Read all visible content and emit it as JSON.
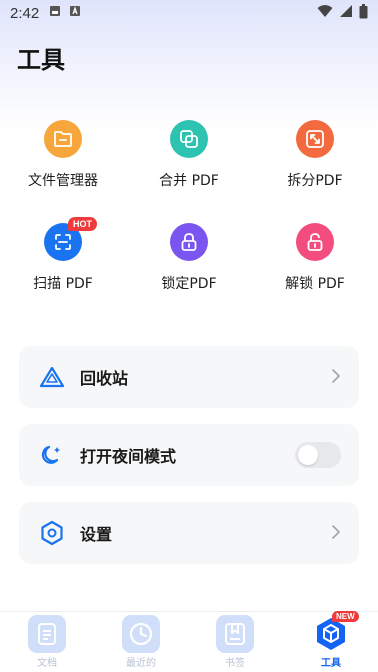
{
  "status_bar": {
    "time": "2:42"
  },
  "header": {
    "title": "工具"
  },
  "tools": [
    {
      "label": "文件管理器",
      "icon": "folder-icon",
      "color": "#f7a63b"
    },
    {
      "label": "合并 PDF",
      "icon": "merge-icon",
      "color": "#2ec2b1"
    },
    {
      "label": "拆分PDF",
      "icon": "split-icon",
      "color": "#f26a3d"
    },
    {
      "label": "扫描 PDF",
      "icon": "scan-icon",
      "color": "#1a73f0",
      "badge": "HOT"
    },
    {
      "label": "锁定PDF",
      "icon": "lock-icon",
      "color": "#7b55f0"
    },
    {
      "label": "解锁 PDF",
      "icon": "unlock-icon",
      "color": "#f24d7e"
    }
  ],
  "settings": {
    "recycle": {
      "label": "回收站",
      "icon": "recycle-bin-icon"
    },
    "night_mode": {
      "label": "打开夜间模式",
      "icon": "moon-icon",
      "enabled": false
    },
    "settings": {
      "label": "设置",
      "icon": "hexagon-settings-icon"
    }
  },
  "bottom_nav": [
    {
      "label": "文档",
      "icon": "document-icon",
      "active": false
    },
    {
      "label": "最近的",
      "icon": "clock-icon",
      "active": false
    },
    {
      "label": "书签",
      "icon": "bookmark-icon",
      "active": false
    },
    {
      "label": "工具",
      "icon": "tools-icon",
      "active": true,
      "badge": "NEW"
    }
  ],
  "colors": {
    "accent": "#1463f3",
    "card_bg": "#f6f7f9",
    "badge_red": "#ef3b3b"
  }
}
